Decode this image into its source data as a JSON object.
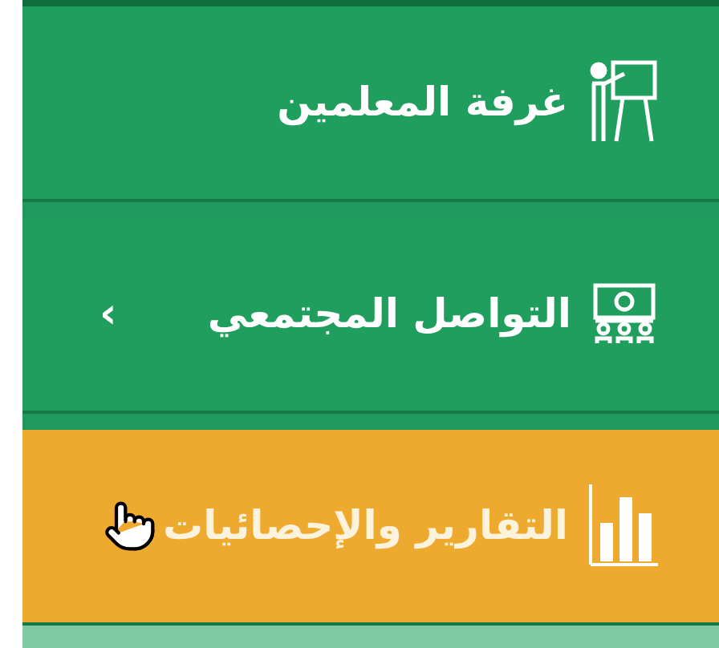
{
  "menu": [
    {
      "label": "غرفة المعلمين",
      "kind": "teachers",
      "selected": false
    },
    {
      "label": "التواصل المجتمعي",
      "kind": "community",
      "selected": false,
      "submenu_glyph": "‹"
    },
    {
      "label": "التقارير والإحصائيات",
      "kind": "reports",
      "selected": true
    }
  ]
}
